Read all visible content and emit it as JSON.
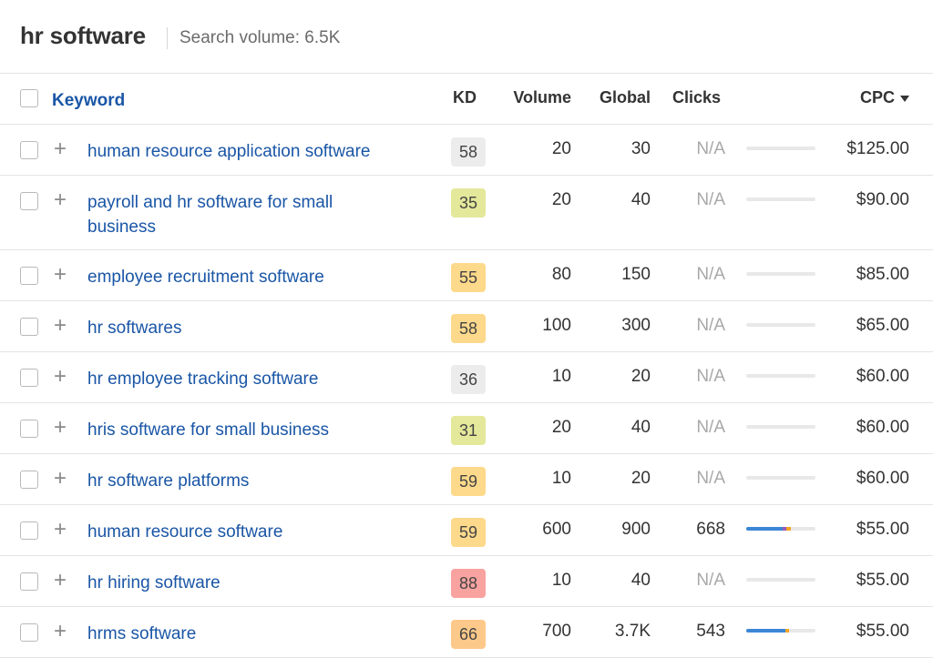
{
  "header": {
    "title": "hr software",
    "search_volume": "Search volume: 6.5K"
  },
  "columns": {
    "keyword": "Keyword",
    "kd": "KD",
    "volume": "Volume",
    "global": "Global",
    "clicks": "Clicks",
    "cpc": "CPC"
  },
  "colors": {
    "link": "#1a56a6",
    "kd_gray": "#ececec",
    "kd_yellow_green": "#e4e89a",
    "kd_orange": "#fdd98b",
    "kd_red": "#f8a3a0",
    "bar_blue": "#3b86d6",
    "bar_orange": "#f5a623",
    "bar_purple": "#9b59b6"
  },
  "rows": [
    {
      "keyword": "human resource application software",
      "kd": "58",
      "kd_color": "#ececec",
      "volume": "20",
      "global": "30",
      "clicks": "N/A",
      "clicks_bar": [],
      "cpc": "$125.00"
    },
    {
      "keyword": "payroll and hr software for small business",
      "kd": "35",
      "kd_color": "#e4e89a",
      "volume": "20",
      "global": "40",
      "clicks": "N/A",
      "clicks_bar": [],
      "cpc": "$90.00"
    },
    {
      "keyword": "employee recruitment software",
      "kd": "55",
      "kd_color": "#fdd98b",
      "volume": "80",
      "global": "150",
      "clicks": "N/A",
      "clicks_bar": [],
      "cpc": "$85.00"
    },
    {
      "keyword": "hr softwares",
      "kd": "58",
      "kd_color": "#fdd98b",
      "volume": "100",
      "global": "300",
      "clicks": "N/A",
      "clicks_bar": [],
      "cpc": "$65.00"
    },
    {
      "keyword": "hr employee tracking software",
      "kd": "36",
      "kd_color": "#ececec",
      "volume": "10",
      "global": "20",
      "clicks": "N/A",
      "clicks_bar": [],
      "cpc": "$60.00"
    },
    {
      "keyword": "hris software for small business",
      "kd": "31",
      "kd_color": "#e4e89a",
      "volume": "20",
      "global": "40",
      "clicks": "N/A",
      "clicks_bar": [],
      "cpc": "$60.00"
    },
    {
      "keyword": "hr software platforms",
      "kd": "59",
      "kd_color": "#fdd98b",
      "volume": "10",
      "global": "20",
      "clicks": "N/A",
      "clicks_bar": [],
      "cpc": "$60.00"
    },
    {
      "keyword": "human resource software",
      "kd": "59",
      "kd_color": "#fdd98b",
      "volume": "600",
      "global": "900",
      "clicks": "668",
      "clicks_bar": [
        {
          "color": "#3b86d6",
          "share": 0.52
        },
        {
          "color": "#9b59b6",
          "share": 0.06
        },
        {
          "color": "#f5a623",
          "share": 0.06
        }
      ],
      "cpc": "$55.00"
    },
    {
      "keyword": "hr hiring software",
      "kd": "88",
      "kd_color": "#f8a3a0",
      "volume": "10",
      "global": "40",
      "clicks": "N/A",
      "clicks_bar": [],
      "cpc": "$55.00"
    },
    {
      "keyword": "hrms software",
      "kd": "66",
      "kd_color": "#fdc98a",
      "volume": "700",
      "global": "3.7K",
      "clicks": "543",
      "clicks_bar": [
        {
          "color": "#3b86d6",
          "share": 0.56
        },
        {
          "color": "#f5a623",
          "share": 0.06
        }
      ],
      "cpc": "$55.00"
    }
  ]
}
